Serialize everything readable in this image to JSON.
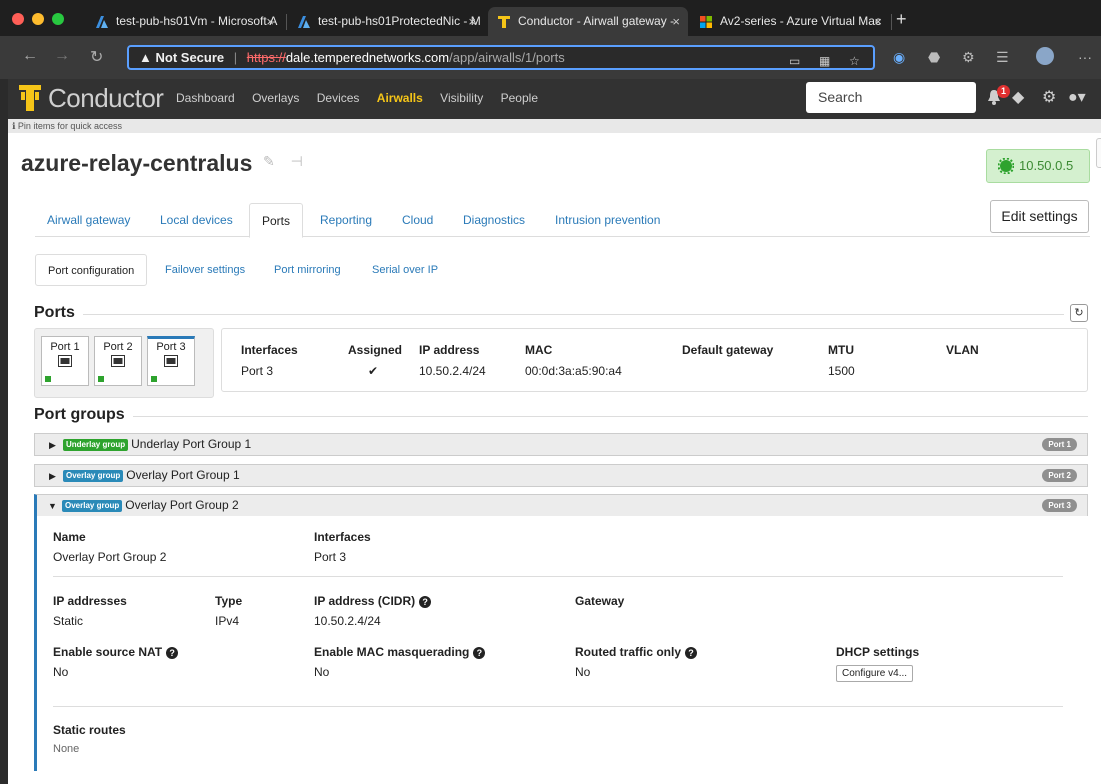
{
  "browser": {
    "tabs": [
      {
        "title": "test-pub-hs01Vm - Microsoft A"
      },
      {
        "title": "test-pub-hs01ProtectedNic - M"
      },
      {
        "title": "Conductor - Airwall gateway -"
      },
      {
        "title": "Av2-series - Azure Virtual Mac"
      }
    ],
    "address": {
      "security": "Not Secure",
      "protocol": "https://",
      "host": "dale.temperednetworks.com",
      "path": "/app/airwalls/1/ports"
    }
  },
  "app": {
    "brand": "Conductor",
    "nav": [
      "Dashboard",
      "Overlays",
      "Devices",
      "Airwalls",
      "Visibility",
      "People"
    ],
    "active_nav": "Airwalls",
    "search_placeholder": "Search",
    "notifications_count": "1",
    "pin_hint": "Pin items for quick access"
  },
  "page": {
    "title": "azure-relay-centralus",
    "version": "10.50.0.5",
    "tabs": [
      "Airwall gateway",
      "Local devices",
      "Ports",
      "Reporting",
      "Cloud",
      "Diagnostics",
      "Intrusion prevention"
    ],
    "active_tab": "Ports",
    "edit_label": "Edit settings",
    "subtabs": [
      "Port configuration",
      "Failover settings",
      "Port mirroring",
      "Serial over IP"
    ],
    "active_subtab": "Port configuration"
  },
  "ports": {
    "title": "Ports",
    "items": [
      {
        "label": "Port 1"
      },
      {
        "label": "Port 2"
      },
      {
        "label": "Port 3"
      }
    ],
    "selected": "Port 3",
    "table": {
      "headers": {
        "interfaces": "Interfaces",
        "assigned": "Assigned",
        "ip": "IP address",
        "mac": "MAC",
        "gateway": "Default gateway",
        "mtu": "MTU",
        "vlan": "VLAN"
      },
      "row": {
        "interfaces": "Port 3",
        "assigned": "✔",
        "ip": "10.50.2.4/24",
        "mac": "00:0d:3a:a5:90:a4",
        "gateway": "",
        "mtu": "1500",
        "vlan": ""
      }
    }
  },
  "port_groups": {
    "title": "Port groups",
    "groups": [
      {
        "tag": "Underlay group",
        "name": "Underlay Port Group 1",
        "port": "Port 1",
        "expanded": false
      },
      {
        "tag": "Overlay group",
        "name": "Overlay Port Group 1",
        "port": "Port 2",
        "expanded": false
      },
      {
        "tag": "Overlay group",
        "name": "Overlay Port Group 2",
        "port": "Port 3",
        "expanded": true
      }
    ],
    "details": {
      "name_label": "Name",
      "name_value": "Overlay Port Group 2",
      "interfaces_label": "Interfaces",
      "interfaces_value": "Port 3",
      "ipaddrs_label": "IP addresses",
      "ipaddrs_value": "Static",
      "type_label": "Type",
      "type_value": "IPv4",
      "cidr_label": "IP address (CIDR)",
      "cidr_value": "10.50.2.4/24",
      "gateway_label": "Gateway",
      "gateway_value": "",
      "snat_label": "Enable source NAT",
      "snat_value": "No",
      "macmasq_label": "Enable MAC masquerading",
      "macmasq_value": "No",
      "routed_label": "Routed traffic only",
      "routed_value": "No",
      "dhcp_label": "DHCP settings",
      "dhcp_button": "Configure v4...",
      "routes_label": "Static routes",
      "routes_value": "None"
    }
  },
  "colors": {
    "accent": "#2a7ab8",
    "brand_gold": "#f5c518",
    "underlay": "#2ea32e",
    "overlay": "#2a8ab8"
  }
}
